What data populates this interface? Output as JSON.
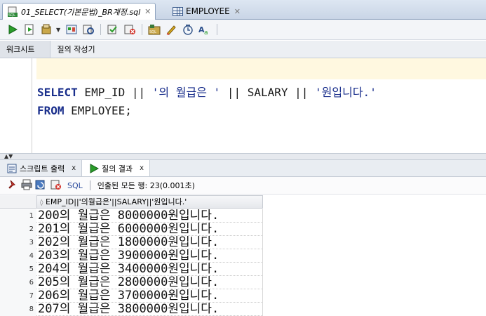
{
  "editor_tabs": [
    {
      "label": "01_SELECT(기본문법)_BR계정.sql",
      "icon": "sql-file-icon",
      "active": true
    },
    {
      "label": "EMPLOYEE",
      "icon": "table-grid-icon",
      "active": false
    }
  ],
  "toolbar": {
    "icons": [
      "run-statement-icon",
      "run-script-icon",
      "commit-icon",
      "dropdown-icon",
      "explain-plan-icon",
      "autotrace-icon",
      "rollback-icon",
      "sql-tuning-icon",
      "unshared-sql-icon",
      "clear-icon",
      "history-icon",
      "format-icon"
    ]
  },
  "worksheet_tabs": [
    "워크시트",
    "질의 작성기"
  ],
  "editor": {
    "line1": {
      "kw_select": "SELECT",
      "col": " EMP_ID || ",
      "str1": "'의 월급은 '",
      "mid": " || SALARY || ",
      "str2": "'원입니다.'"
    },
    "line2": {
      "kw_from": "FROM",
      "table": " EMPLOYEE;"
    }
  },
  "result_tabs": [
    {
      "label": "스크립트 출력",
      "close": "x"
    },
    {
      "label": "질의 결과",
      "close": "x"
    }
  ],
  "result_toolbar": {
    "sql_label": "SQL",
    "status": "인출된 모든 행: 23(0.001초)"
  },
  "grid": {
    "column_header": "EMP_ID||'의월급은'||SALARY||'원입니다.'",
    "rows": [
      {
        "num": "1",
        "value": "200의 월급은 8000000원입니다."
      },
      {
        "num": "2",
        "value": "201의 월급은 6000000원입니다."
      },
      {
        "num": "3",
        "value": "202의 월급은 1800000원입니다."
      },
      {
        "num": "4",
        "value": "203의 월급은 3900000원입니다."
      },
      {
        "num": "5",
        "value": "204의 월급은 3400000원입니다."
      },
      {
        "num": "6",
        "value": "205의 월급은 2800000원입니다."
      },
      {
        "num": "7",
        "value": "206의 월급은 3700000원입니다."
      },
      {
        "num": "8",
        "value": "207의 월급은 3800000원입니다."
      }
    ]
  },
  "colors": {
    "keyword": "#1a2f8c",
    "current_line": "#fff8e0",
    "tab_bar": "#c9d5e6"
  }
}
